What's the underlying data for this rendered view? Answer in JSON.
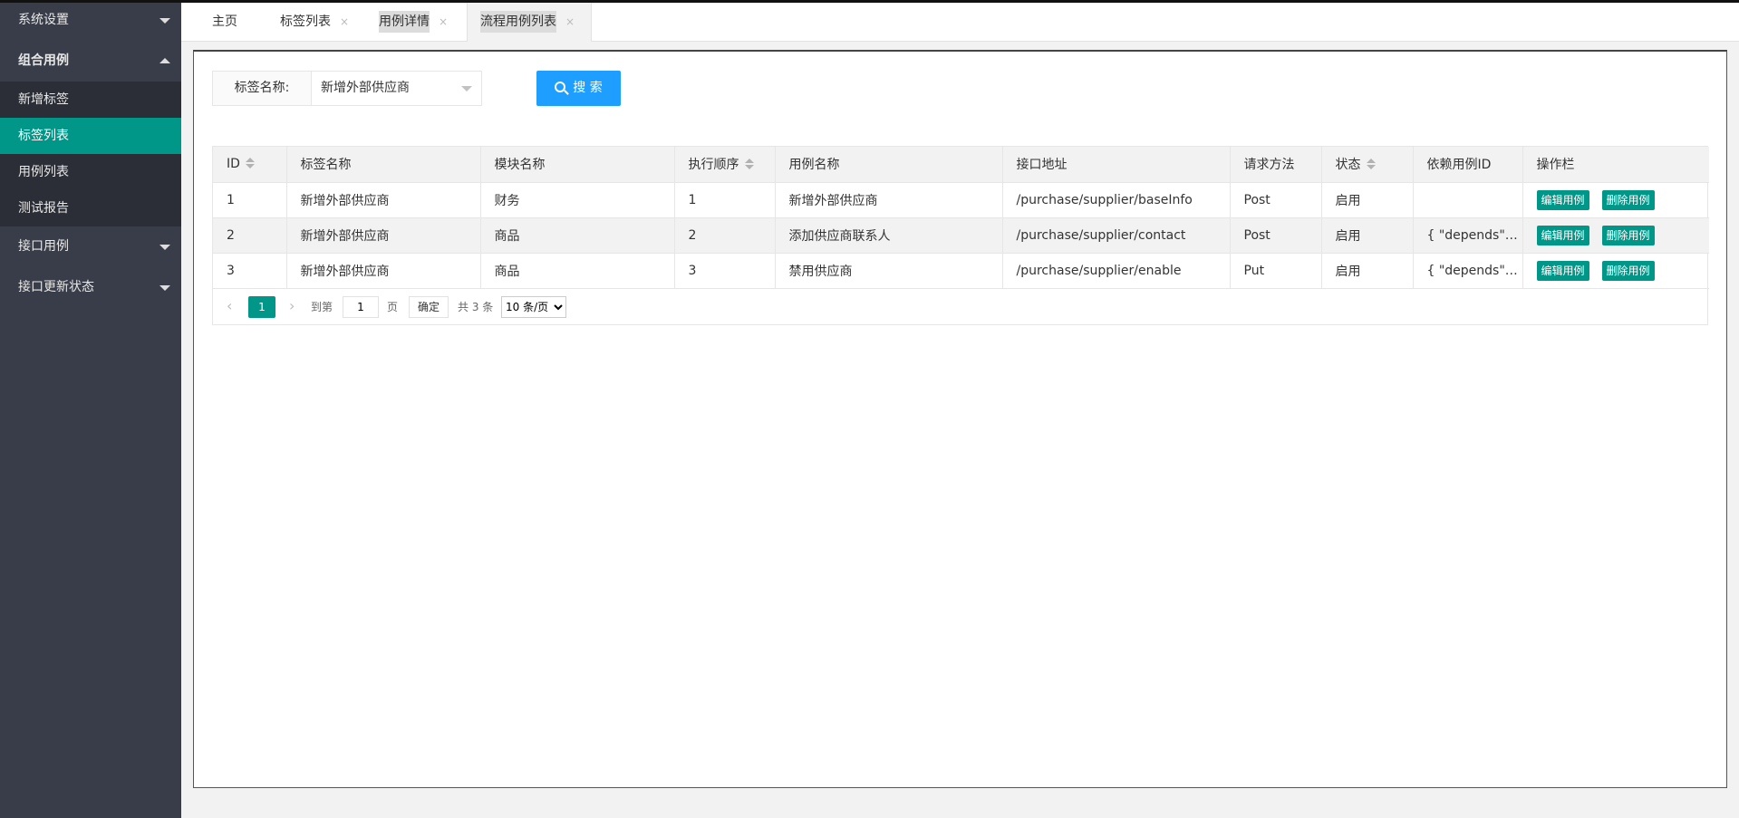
{
  "sidebar": {
    "groups": [
      {
        "label": "系统设置"
      },
      {
        "label": "组合用例",
        "items": [
          "新增标签",
          "标签列表",
          "用例列表",
          "测试报告"
        ]
      },
      {
        "label": "接口用例"
      },
      {
        "label": "接口更新状态"
      }
    ]
  },
  "tabs": [
    {
      "label": "主页"
    },
    {
      "label": "标签列表"
    },
    {
      "label": "用例详情"
    },
    {
      "label": "流程用例列表"
    }
  ],
  "tab_close_glyph": "×",
  "search": {
    "label": "标签名称:",
    "selected": "新增外部供应商",
    "button_label": "搜 索"
  },
  "table": {
    "headers": [
      "ID",
      "标签名称",
      "模块名称",
      "执行顺序",
      "用例名称",
      "接口地址",
      "请求方法",
      "状态",
      "依赖用例ID",
      "操作栏"
    ],
    "rows": [
      [
        "1",
        "新增外部供应商",
        "财务",
        "1",
        "新增外部供应商",
        "/purchase/supplier/baseInfo",
        "Post",
        "启用",
        ""
      ],
      [
        "2",
        "新增外部供应商",
        "商品",
        "2",
        "添加供应商联系人",
        "/purchase/supplier/contact",
        "Post",
        "启用",
        "{ \"depends\"…"
      ],
      [
        "3",
        "新增外部供应商",
        "商品",
        "3",
        "禁用供应商",
        "/purchase/supplier/enable",
        "Put",
        "启用",
        "{ \"depends\"…"
      ]
    ],
    "edit_label": "编辑用例",
    "delete_label": "删除用例"
  },
  "pager": {
    "prev": "‹",
    "next": "›",
    "current": "1",
    "goto_prefix": "到第",
    "goto_value": "1",
    "goto_suffix": "页",
    "confirm": "确定",
    "total": "共 3 条",
    "page_size": "10 条/页"
  },
  "colors": {
    "sidebar_bg": "#393d49",
    "active_green": "#009688",
    "search_blue": "#1e9fff"
  }
}
